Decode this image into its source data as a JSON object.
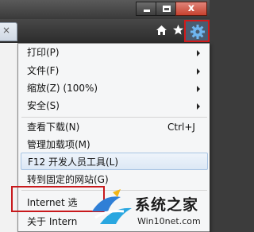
{
  "tab": {
    "close_glyph": "×"
  },
  "window": {
    "close_glyph": "x"
  },
  "commandbar": {
    "home_icon": "home-icon",
    "favorites_icon": "star-icon",
    "tools_icon": "gear-icon"
  },
  "menu": {
    "items": [
      {
        "label": "打印(P)",
        "submenu": true
      },
      {
        "label": "文件(F)",
        "submenu": true
      },
      {
        "label": "缩放(Z) (100%)",
        "submenu": true
      },
      {
        "label": "安全(S)",
        "submenu": true
      },
      {
        "label": "查看下载(N)",
        "shortcut": "Ctrl+J"
      },
      {
        "label": "管理加载项(M)"
      },
      {
        "label": "F12 开发人员工具(L)"
      },
      {
        "label": "转到固定的网站(G)"
      },
      {
        "label": "Internet 选"
      },
      {
        "label": "关于 Intern"
      }
    ]
  },
  "watermark": {
    "title": "系统之家",
    "url": "Win10net.com"
  },
  "colors": {
    "highlight_border": "#c8191c",
    "menu_bg": "#f5f6f7",
    "hover_bg": "#dce8f5"
  }
}
